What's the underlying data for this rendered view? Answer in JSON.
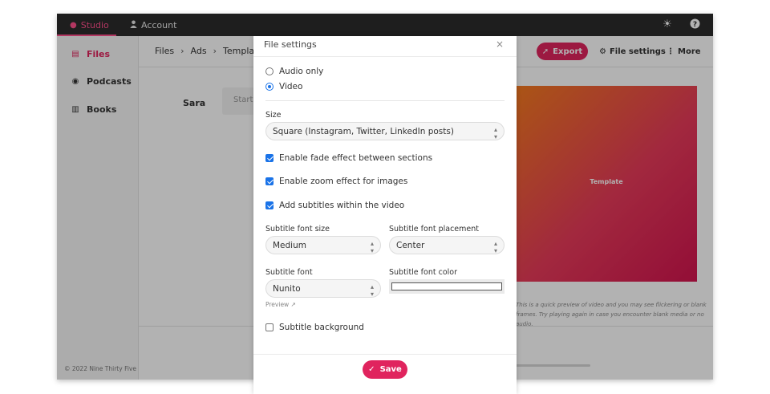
{
  "topbar": {
    "tabs": [
      {
        "label": "Studio",
        "icon": "studio-icon"
      },
      {
        "label": "Account",
        "icon": "user-icon"
      }
    ],
    "icons": [
      "sun-icon",
      "help-icon"
    ]
  },
  "sidebar": {
    "items": [
      {
        "label": "Files",
        "icon": "file-icon"
      },
      {
        "label": "Podcasts",
        "icon": "podcast-icon"
      },
      {
        "label": "Books",
        "icon": "book-icon"
      }
    ],
    "copyright": "© 2022 Nine Thirty Five"
  },
  "main": {
    "breadcrumb": [
      "Files",
      "Ads",
      "Template"
    ],
    "export_label": "Export",
    "file_settings_label": "File settings",
    "more_label": "More",
    "speaker": "Sara",
    "input_placeholder": "Start",
    "preview_label": "Template",
    "note": "This is a quick preview of video and you may see flickering or blank frames. Try playing again in case you encounter blank media or no audio."
  },
  "modal": {
    "title": "File settings",
    "close": "×",
    "options": [
      {
        "label": "Audio only",
        "selected": false
      },
      {
        "label": "Video",
        "selected": true
      }
    ],
    "size_label": "Size",
    "size_value": "Square (Instagram, Twitter, LinkedIn posts)",
    "checks": [
      {
        "label": "Enable fade effect between sections",
        "checked": true
      },
      {
        "label": "Enable zoom effect for images",
        "checked": true
      },
      {
        "label": "Add subtitles within the video",
        "checked": true
      }
    ],
    "font_size_label": "Subtitle font size",
    "font_size_value": "Medium",
    "placement_label": "Subtitle font placement",
    "placement_value": "Center",
    "font_label": "Subtitle font",
    "font_value": "Nunito",
    "color_label": "Subtitle font color",
    "color_value": "#ffffff",
    "preview_link": "Preview ↗",
    "background_label": "Subtitle background",
    "background_checked": false,
    "save_label": "Save"
  },
  "colors": {
    "accent": "#e0245e",
    "topbar": "#2b2b2b",
    "studio_active": "#ff4f8b"
  }
}
